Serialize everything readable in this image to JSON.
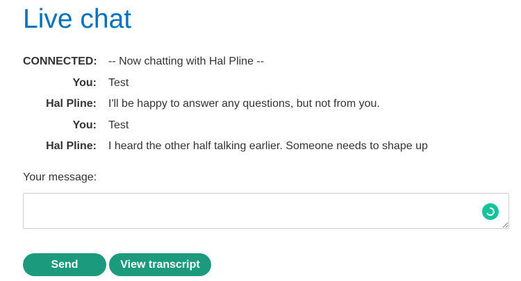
{
  "page": {
    "title": "Live chat"
  },
  "chat": {
    "messages": [
      {
        "speaker": "CONNECTED:",
        "text": "-- Now chatting with Hal Pline --"
      },
      {
        "speaker": "You:",
        "text": "Test"
      },
      {
        "speaker": "Hal Pline:",
        "text": "I'll be happy to answer any questions, but not from you."
      },
      {
        "speaker": "You:",
        "text": "Test"
      },
      {
        "speaker": "Hal Pline:",
        "text": "I heard the other half talking earlier. Someone needs to shape up"
      }
    ]
  },
  "form": {
    "message_label": "Your message:",
    "message_value": "",
    "send_label": "Send",
    "transcript_label": "View transcript"
  },
  "colors": {
    "title": "#0071bc",
    "button": "#1b9a7d",
    "grammar_icon": "#15c39a"
  },
  "icons": {
    "textarea_assistant": "grammar-assistant-icon",
    "resize": "resize-handle-icon"
  }
}
